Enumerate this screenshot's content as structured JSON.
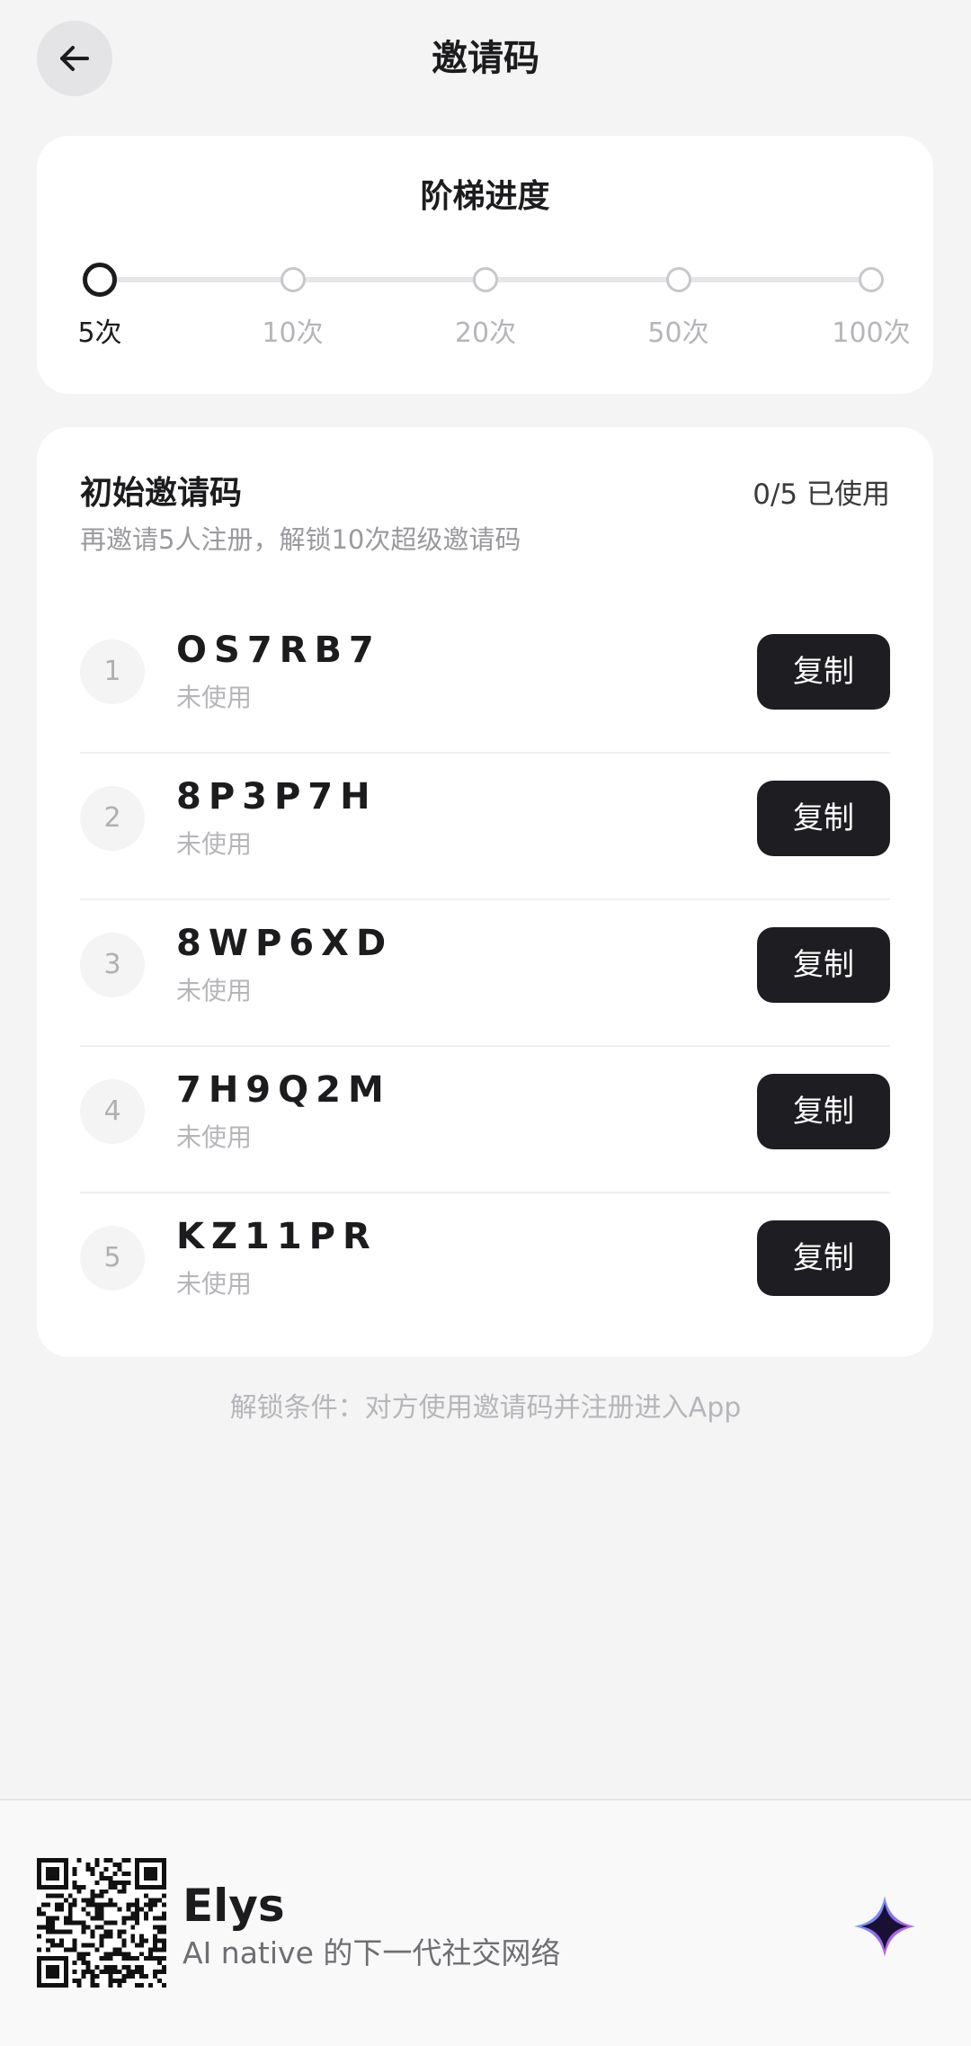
{
  "header": {
    "title": "邀请码"
  },
  "progress": {
    "title": "阶梯进度",
    "steps": [
      {
        "label": "5次",
        "active": true
      },
      {
        "label": "10次",
        "active": false
      },
      {
        "label": "20次",
        "active": false
      },
      {
        "label": "50次",
        "active": false
      },
      {
        "label": "100次",
        "active": false
      }
    ]
  },
  "codes": {
    "title": "初始邀请码",
    "usage": "0/5 已使用",
    "subtitle": "再邀请5人注册，解锁10次超级邀请码",
    "copy_label": "复制",
    "items": [
      {
        "index": "1",
        "code": "OS7RB7",
        "status": "未使用"
      },
      {
        "index": "2",
        "code": "8P3P7H",
        "status": "未使用"
      },
      {
        "index": "3",
        "code": "8WP6XD",
        "status": "未使用"
      },
      {
        "index": "4",
        "code": "7H9Q2M",
        "status": "未使用"
      },
      {
        "index": "5",
        "code": "KZ11PR",
        "status": "未使用"
      }
    ]
  },
  "unlock_note": "解锁条件：对方使用邀请码并注册进入App",
  "footer": {
    "brand_name": "Elys",
    "tagline": "AI native 的下一代社交网络"
  },
  "icons": {
    "back": "arrow-left-icon",
    "qr": "qr-code-icon",
    "logo": "elys-logo-icon"
  },
  "colors": {
    "background": "#f4f4f5",
    "card": "#ffffff",
    "primary": "#1e1e22",
    "muted": "#b6b6ba"
  }
}
